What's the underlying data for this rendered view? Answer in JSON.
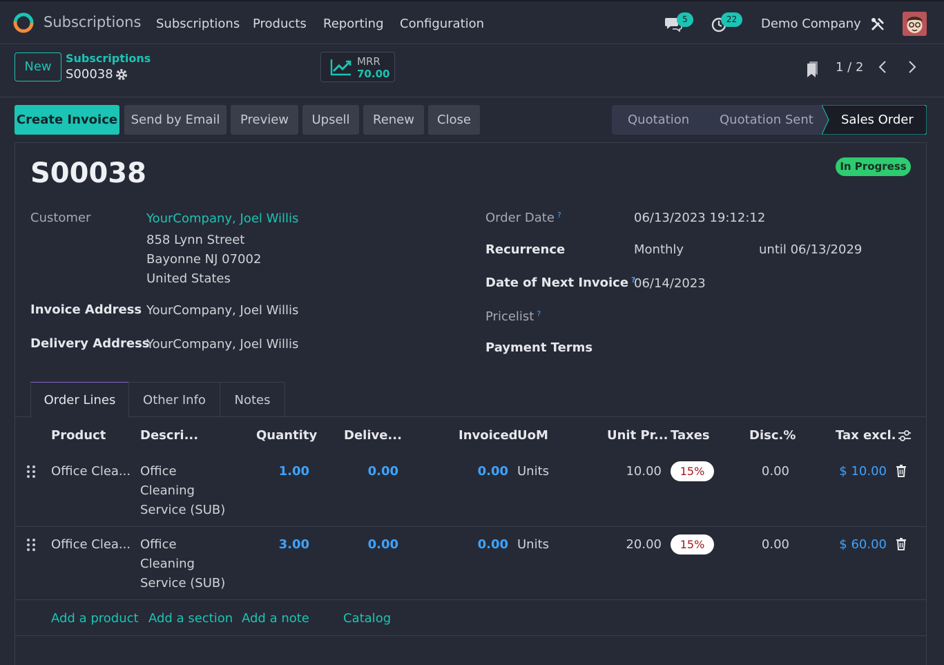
{
  "navbar": {
    "app_title": "Subscriptions",
    "menu": [
      "Subscriptions",
      "Products",
      "Reporting",
      "Configuration"
    ],
    "messages_count": "5",
    "activities_count": "22",
    "company": "Demo Company"
  },
  "control_panel": {
    "new_label": "New",
    "breadcrumb_parent": "Subscriptions",
    "record_name": "S00038",
    "mrr_label": "MRR",
    "mrr_value": "70.00",
    "pager": "1 / 2"
  },
  "actions": [
    "Create Invoice",
    "Send by Email",
    "Preview",
    "Upsell",
    "Renew",
    "Close"
  ],
  "stages": [
    "Quotation",
    "Quotation Sent",
    "Sales Order"
  ],
  "form": {
    "title": "S00038",
    "status_ribbon": "In Progress",
    "customer_label": "Customer",
    "customer_name": "YourCompany, Joel Willis",
    "address_lines": [
      "858 Lynn Street",
      "Bayonne NJ 07002",
      "United States"
    ],
    "invoice_address_label": "Invoice Address",
    "invoice_address": "YourCompany, Joel Willis",
    "delivery_address_label": "Delivery Address",
    "delivery_address": "YourCompany, Joel Willis",
    "order_date_label": "Order Date",
    "order_date": "06/13/2023 19:12:12",
    "recurrence_label": "Recurrence",
    "recurrence": "Monthly",
    "recurrence_until": "until 06/13/2029",
    "next_invoice_label": "Date of Next Invoice",
    "next_invoice": "06/14/2023",
    "pricelist_label": "Pricelist",
    "payment_terms_label": "Payment Terms",
    "help_mark": "?"
  },
  "tabs": [
    "Order Lines",
    "Other Info",
    "Notes"
  ],
  "table": {
    "headers": [
      "Product",
      "Descri...",
      "Quantity",
      "Delive...",
      "Invoiced",
      "UoM",
      "Unit Pr...",
      "Taxes",
      "Disc.%",
      "Tax excl."
    ],
    "rows": [
      {
        "product": "Office Clea...",
        "desc": [
          "Office",
          "Cleaning",
          "Service (SUB)"
        ],
        "qty": "1.00",
        "delivered": "0.00",
        "invoiced": "0.00",
        "uom": "Units",
        "unit_price": "10.00",
        "tax": "15%",
        "disc": "0.00",
        "subtotal": "$ 10.00"
      },
      {
        "product": "Office Clea...",
        "desc": [
          "Office",
          "Cleaning",
          "Service (SUB)"
        ],
        "qty": "3.00",
        "delivered": "0.00",
        "invoiced": "0.00",
        "uom": "Units",
        "unit_price": "20.00",
        "tax": "15%",
        "disc": "0.00",
        "subtotal": "$ 60.00"
      }
    ],
    "add_links": [
      "Add a product",
      "Add a section",
      "Add a note",
      "Catalog"
    ]
  },
  "colors": {
    "accent": "#1bc4b4",
    "link_blue": "#3ea3ff",
    "background": "#262a36",
    "ribbon": "#2ecc71"
  }
}
